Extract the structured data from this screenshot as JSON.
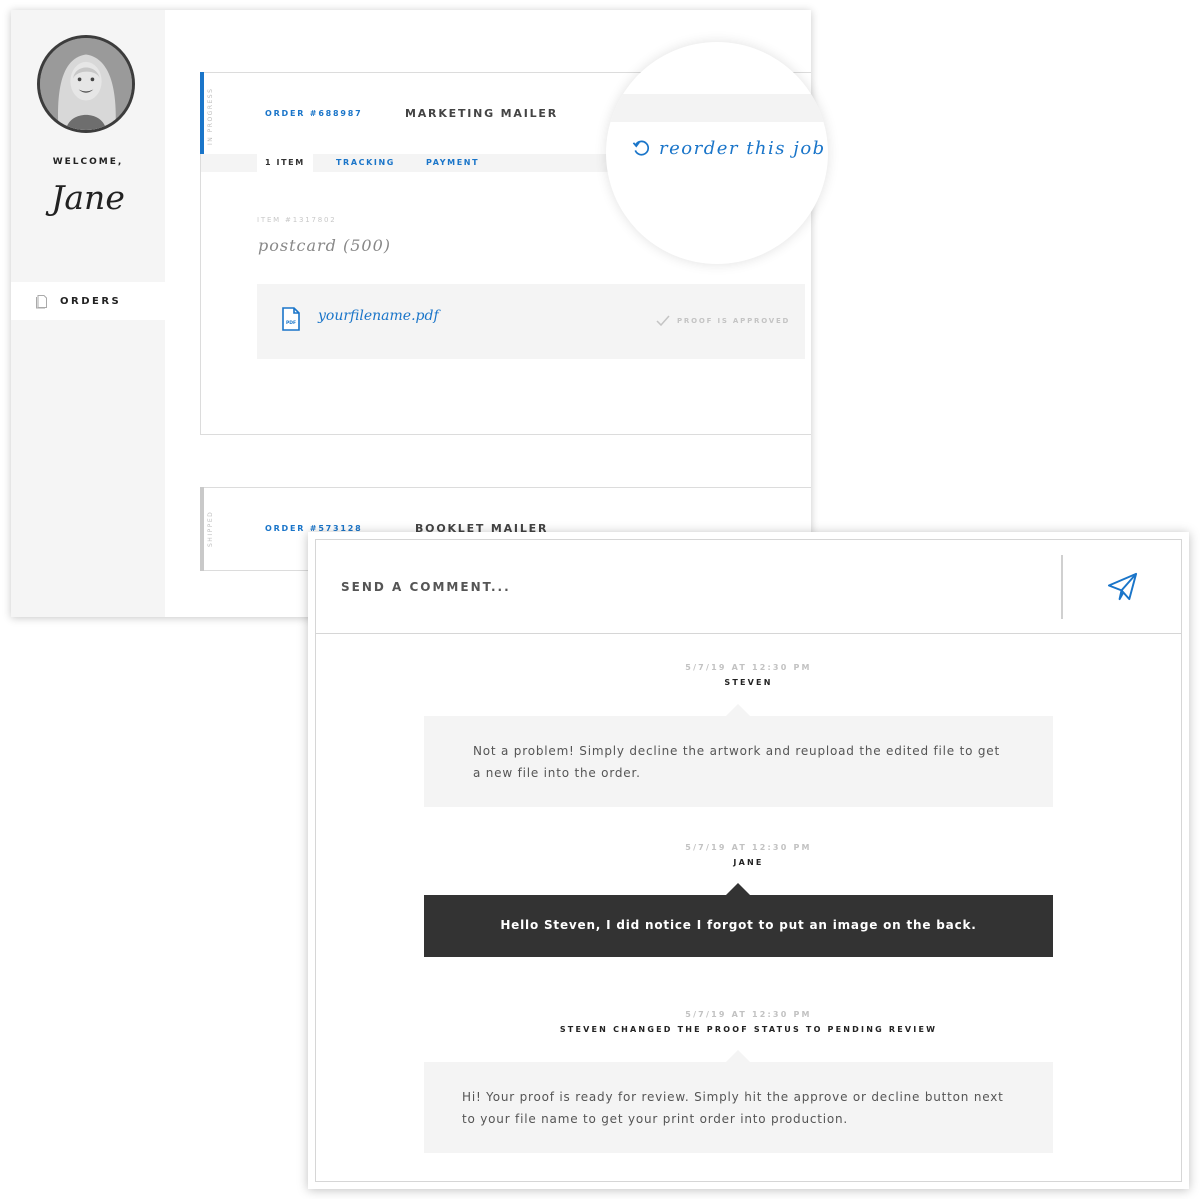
{
  "sidebar": {
    "welcome_label": "WELCOME,",
    "user_name": "Jane",
    "nav": {
      "orders_label": "ORDERS",
      "orders_icon": "document-icon"
    }
  },
  "orders": [
    {
      "status": "IN PROGRESS",
      "status_color": "#1a75c9",
      "order_number": "ORDER #688987",
      "title": "MARKETING MAILER",
      "tabs": [
        "1 ITEM",
        "TRACKING",
        "PAYMENT"
      ],
      "item_number": "ITEM #1317802",
      "item_name": "postcard (500)",
      "file": {
        "icon": "pdf-icon",
        "icon_text": "PDF",
        "name": "yourfilename.pdf",
        "proof_status": "PROOF IS APPROVED"
      },
      "reorder_label": "reorder this job"
    },
    {
      "status": "SHIPPED",
      "status_color": "#c9c9c9",
      "order_number": "ORDER #573128",
      "title": "BOOKLET MAILER"
    }
  ],
  "comments": {
    "input_placeholder": "SEND A COMMENT...",
    "send_icon": "paper-plane-icon",
    "accent": "#1a75c9",
    "messages": [
      {
        "time": "5/7/19  AT 12:30 PM",
        "author": "STEVEN",
        "text": "Not a problem! Simply decline the artwork and reupload the edited file to get a new file into the order.",
        "style": "light"
      },
      {
        "time": "5/7/19  AT 12:30 PM",
        "author": "JANE",
        "text": "Hello Steven, I did notice I forgot to put an image on the back.",
        "style": "dark"
      },
      {
        "time": "5/7/19  AT 12:30 PM",
        "author": "STEVEN CHANGED THE PROOF STATUS TO PENDING REVIEW",
        "text": "Hi! Your proof is ready for review. Simply hit the approve or decline button next to your file name to get your print order into production.",
        "style": "light"
      }
    ]
  }
}
